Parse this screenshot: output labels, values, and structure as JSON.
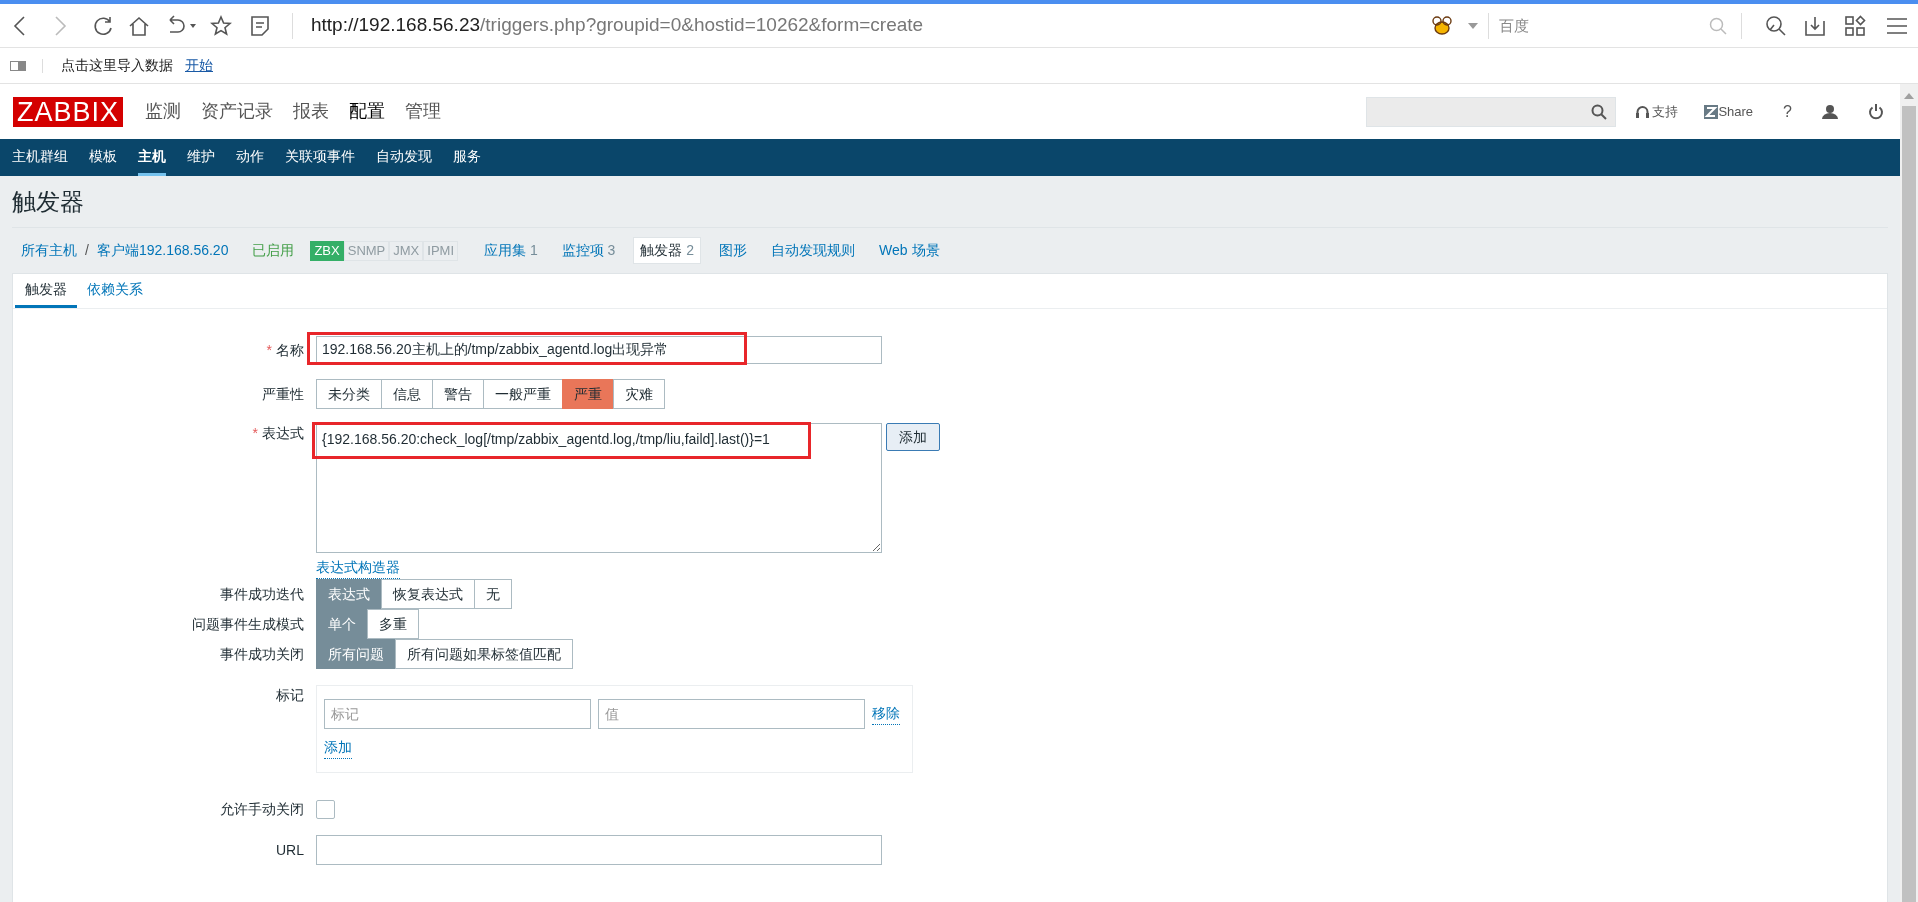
{
  "browser": {
    "url_host": "http://192.168.56.23",
    "url_path": "/triggers.php?groupid=0&hostid=10262&form=create",
    "search_placeholder": "百度",
    "bookmark_text": "点击这里导入数据",
    "bookmark_link": "开始"
  },
  "header": {
    "logo": "ZABBIX",
    "menu": [
      {
        "label": "监测",
        "selected": false
      },
      {
        "label": "资产记录",
        "selected": false
      },
      {
        "label": "报表",
        "selected": false
      },
      {
        "label": "配置",
        "selected": true
      },
      {
        "label": "管理",
        "selected": false
      }
    ],
    "support": "支持",
    "share": "Share",
    "help": "?"
  },
  "submenu": [
    {
      "label": "主机群组",
      "selected": false
    },
    {
      "label": "模板",
      "selected": false
    },
    {
      "label": "主机",
      "selected": true
    },
    {
      "label": "维护",
      "selected": false
    },
    {
      "label": "动作",
      "selected": false
    },
    {
      "label": "关联项事件",
      "selected": false
    },
    {
      "label": "自动发现",
      "selected": false
    },
    {
      "label": "服务",
      "selected": false
    }
  ],
  "page_title": "触发器",
  "breadcrumb": {
    "all_hosts": "所有主机",
    "separator": "/",
    "host": "客户端192.168.56.20",
    "status": "已启用",
    "availability": [
      {
        "label": "ZBX",
        "on": true
      },
      {
        "label": "SNMP",
        "on": false
      },
      {
        "label": "JMX",
        "on": false
      },
      {
        "label": "IPMI",
        "on": false
      }
    ],
    "links": [
      {
        "label": "应用集",
        "count": "1",
        "selected": false
      },
      {
        "label": "监控项",
        "count": "3",
        "selected": false
      },
      {
        "label": "触发器",
        "count": "2",
        "selected": true
      },
      {
        "label": "图形",
        "selected": false
      },
      {
        "label": "自动发现规则",
        "selected": false
      },
      {
        "label": "Web 场景",
        "selected": false
      }
    ]
  },
  "tabs": [
    {
      "label": "触发器",
      "selected": true
    },
    {
      "label": "依赖关系",
      "selected": false
    }
  ],
  "form": {
    "name": {
      "label": "名称",
      "required_mark": "*",
      "value": "192.168.56.20主机上的/tmp/zabbix_agentd.log出现异常"
    },
    "severity": {
      "label": "严重性",
      "options": [
        {
          "label": "未分类",
          "selected": false
        },
        {
          "label": "信息",
          "selected": false
        },
        {
          "label": "警告",
          "selected": false
        },
        {
          "label": "一般严重",
          "selected": false
        },
        {
          "label": "严重",
          "selected": true
        },
        {
          "label": "灾难",
          "selected": false
        }
      ]
    },
    "expression": {
      "label": "表达式",
      "required_mark": "*",
      "value": "{192.168.56.20:check_log[/tmp/zabbix_agentd.log,/tmp/liu,faild].last()}=1",
      "add_button": "添加",
      "constructor_link": "表达式构造器"
    },
    "toggles": [
      {
        "label": "事件成功迭代",
        "options": [
          {
            "label": "表达式",
            "selected": true
          },
          {
            "label": "恢复表达式",
            "selected": false
          },
          {
            "label": "无",
            "selected": false
          }
        ]
      },
      {
        "label": "问题事件生成模式",
        "options": [
          {
            "label": "单个",
            "selected": true
          },
          {
            "label": "多重",
            "selected": false
          }
        ]
      },
      {
        "label": "事件成功关闭",
        "options": [
          {
            "label": "所有问题",
            "selected": true
          },
          {
            "label": "所有问题如果标签值匹配",
            "selected": false
          }
        ]
      }
    ],
    "tags": {
      "label": "标记",
      "tag_placeholder": "标记",
      "value_placeholder": "值",
      "remove": "移除",
      "add": "添加"
    },
    "manual_close": {
      "label": "允许手动关闭",
      "checked": false
    },
    "url": {
      "label": "URL"
    }
  }
}
